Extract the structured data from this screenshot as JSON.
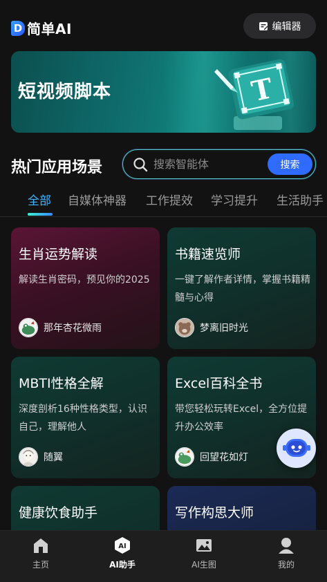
{
  "header": {
    "logo_mark": "D",
    "logo_text": "简单AI",
    "editor_label": "编辑器"
  },
  "banner": {
    "title": "短视频脚本",
    "art_letter": "T"
  },
  "section": {
    "title": "热门应用场景"
  },
  "search": {
    "placeholder": "搜索智能体",
    "button_label": "搜索"
  },
  "tabs": [
    {
      "label": "全部",
      "active": true
    },
    {
      "label": "自媒体神器",
      "active": false
    },
    {
      "label": "工作提效",
      "active": false
    },
    {
      "label": "学习提升",
      "active": false
    },
    {
      "label": "生活助手",
      "active": false
    }
  ],
  "cards": [
    {
      "title": "生肖运势解读",
      "desc": "解读生肖密码，预见你的2025",
      "author": "那年杏花微雨",
      "theme": "pink"
    },
    {
      "title": "书籍速览师",
      "desc": "一键了解作者详情，掌握书籍精髓与心得",
      "author": "梦离旧时光",
      "theme": "teal"
    },
    {
      "title": "MBTI性格全解",
      "desc": "深度剖析16种性格类型，认识自己，理解他人",
      "author": "随翼",
      "theme": "teal"
    },
    {
      "title": "Excel百科全书",
      "desc": "带您轻松玩转Excel，全方位提升办公效率",
      "author": "回望花如灯",
      "theme": "teal"
    },
    {
      "title": "健康饮食助手",
      "desc": "",
      "author": "",
      "theme": "teal"
    },
    {
      "title": "写作构思大师",
      "desc": "",
      "author": "",
      "theme": "blue"
    }
  ],
  "bottom_nav": [
    {
      "label": "主页",
      "icon": "home-icon",
      "active": false
    },
    {
      "label": "AI助手",
      "icon": "ai-assistant-icon",
      "active": true
    },
    {
      "label": "AI生图",
      "icon": "image-icon",
      "active": false
    },
    {
      "label": "我的",
      "icon": "profile-icon",
      "active": false
    }
  ],
  "colors": {
    "accent": "#3db4ff",
    "search_button": "#2f6bff",
    "background": "#121212"
  }
}
